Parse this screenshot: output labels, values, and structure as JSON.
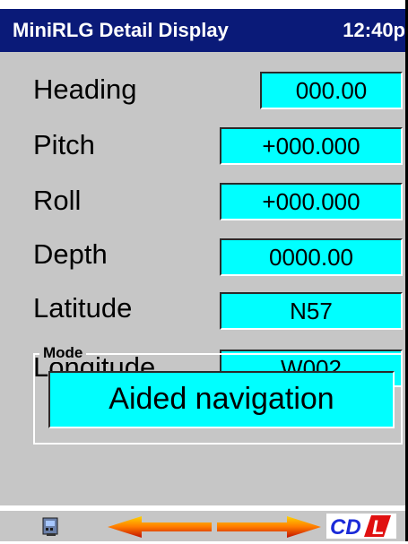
{
  "titlebar": {
    "title": "MiniRLG Detail Display",
    "clock": "12:40p"
  },
  "fields": [
    {
      "label": "Heading",
      "value": "000.00"
    },
    {
      "label": "Pitch",
      "value": "+000.000"
    },
    {
      "label": "Roll",
      "value": "+000.000"
    },
    {
      "label": "Depth",
      "value": "0000.00"
    },
    {
      "label": "Latitude",
      "value": "N57"
    },
    {
      "label": "Longitude",
      "value": "W002"
    }
  ],
  "mode": {
    "legend": "Mode",
    "value": "Aided navigation"
  },
  "taskbar": {
    "left_icon": "keyboard-icon",
    "back_icon": "arrow-left-icon",
    "forward_icon": "arrow-right-icon",
    "logo_text_cd": "CD",
    "logo_text_l": "L"
  },
  "colors": {
    "titlebar": "#0a1a78",
    "panel": "#c6c6c6",
    "field": "#00ffff",
    "logo_blue": "#1a2ad8",
    "logo_red": "#e01010"
  }
}
